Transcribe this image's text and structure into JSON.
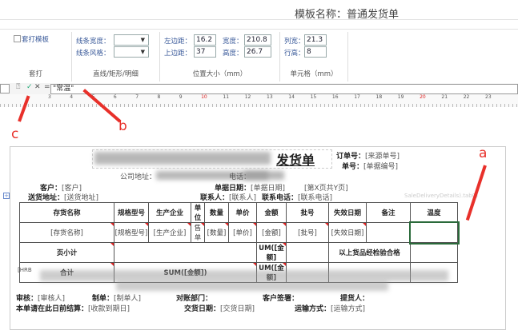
{
  "template_title": "模板名称：普通发货单",
  "toolbar": {
    "overprint": {
      "checkbox_label": "套打模板",
      "checked": false,
      "group_label": "套打"
    },
    "line": {
      "width_label": "线条宽度：",
      "style_label": "线条风格：",
      "group_label": "直线/矩形/明细"
    },
    "position": {
      "left_label": "左边距：",
      "left_value": "16.2",
      "width_label": "宽度：",
      "width_value": "210.8",
      "top_label": "上边距：",
      "top_value": "37",
      "height_label": "高度：",
      "height_value": "26.7",
      "group_label": "位置大小（mm）"
    },
    "cell": {
      "col_label": "列宽：",
      "col_value": "21.3",
      "row_label": "行高：",
      "row_value": "8",
      "group_label": "单元格（mm）"
    }
  },
  "formula": {
    "equals": "=",
    "value": "\"常温\""
  },
  "ruler": [
    "3",
    "4",
    "5",
    "6",
    "7",
    "8",
    "9",
    "10",
    "11",
    "12",
    "13",
    "14",
    "15",
    "16",
    "17",
    "18",
    "19",
    "20",
    "21",
    "22",
    "23"
  ],
  "annotations": {
    "a": "a",
    "b": "b",
    "c": "c"
  },
  "doc": {
    "title": "发货单",
    "order_no_label": "订单号：",
    "order_no": "[来源单号]",
    "bill_no_label": "单号：",
    "bill_no": "[单据编号]",
    "address_label": "公司地址：",
    "phone_label": "电话：",
    "customer_label": "客户：",
    "customer": "[客户]",
    "date_label": "单据日期：",
    "date": "[单据日期]",
    "page": "[第X页共Y页]",
    "ship_addr_label": "送货地址：",
    "ship_addr": "[送货地址]",
    "contact_label": "联系人：",
    "contact": "[联系人]",
    "contact_phone_label": "联系电话：",
    "contact_phone": "[联系电话]",
    "detail_ref": "SaleDeliveryDetails).tab0)",
    "headers": [
      "存货名称",
      "规格型号",
      "生产企业",
      "单位",
      "数量",
      "单价",
      "金额",
      "批号",
      "失效日期",
      "备注",
      "温度"
    ],
    "row": [
      "[存货名称]",
      "[规格型号]",
      "[生产企业]",
      "售单",
      "[数量]",
      "[单价]",
      "[金额]",
      "[批号]",
      "[失效日期]",
      "",
      ""
    ],
    "subtotal_label": "页小计",
    "subtotal_sum": "UM([金额]",
    "inspection": "以上货品经检验合格",
    "total_label": "合计",
    "total_sum_text": "SUM([金额])",
    "total_sum": "UM([金额]",
    "note_label": "[HRB",
    "reviewer_label": "审核：",
    "reviewer": "[审核人]",
    "maker_label": "制单：",
    "maker": "[制单人]",
    "dept_label": "对账部门：",
    "sign_label": "客户签署：",
    "picker_label": "提货人：",
    "settle_label": "本单请在此日前结算：",
    "settle": "[收款到期日]",
    "delivery_date_label": "交货日期：",
    "delivery_date": "[交货日期]",
    "transport_label": "运输方式：",
    "transport": "[运输方式]"
  }
}
